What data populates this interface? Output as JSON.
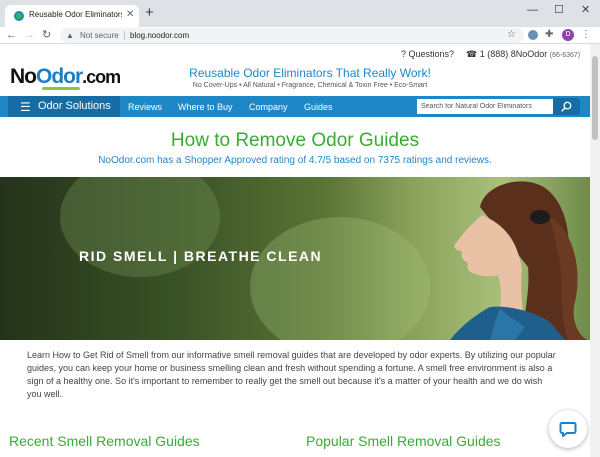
{
  "browser": {
    "tab_title": "Reusable Odor Eliminators That Re",
    "tab_close": "✕",
    "new_tab": "+",
    "window_controls": [
      "—",
      "☐",
      "✕"
    ],
    "back": "←",
    "forward": "→",
    "reload": "↻",
    "security_icon": "▲",
    "security_label": "Not secure",
    "url": "blog.noodor.com",
    "star_icon": "☆",
    "puzzle_icon": "✚",
    "profile_initial": "D",
    "menu_icon": "⋮"
  },
  "header": {
    "questions": "? Questions?",
    "phone_main": "☎ 1 (888) 8NoOdor",
    "phone_digits": "(66-6367)",
    "logo_no": "No",
    "logo_odor": "Odor",
    "logo_com": ".com",
    "tagline": "Reusable Odor Eliminators That Really Work!",
    "subtagline": "No Cover-Ups • All Natural • Fragrance, Chemical & Toxin Free • Eco-Smart"
  },
  "nav": {
    "hamburger": "☰",
    "solutions": "Odor Solutions",
    "links": [
      "Reviews",
      "Where to Buy",
      "Company",
      "Guides"
    ],
    "search_placeholder": "Search for Natural Odor Eliminators"
  },
  "main": {
    "title": "How to Remove Odor Guides",
    "rating": "NoOdor.com has a Shopper Approved rating of 4.7/5 based on 7375 ratings and reviews.",
    "hero_text": "RID SMELL | BREATHE CLEAN",
    "intro": "Learn How to Get Rid of Smell from our informative smell removal guides that are developed by odor experts. By utilizing our popular guides, you can keep your home or business smelling clean and fresh without spending a fortune. A smell free environment is also a sign of a healthy one. So it's important to remember to really get the smell out because it's a matter of your health and we do wish you well.",
    "section_recent": "Recent Smell Removal Guides",
    "section_popular": "Popular Smell Removal Guides"
  },
  "colors": {
    "brand_blue": "#1e88c7",
    "brand_green": "#3aaa35",
    "nav_dark": "#176da3"
  }
}
